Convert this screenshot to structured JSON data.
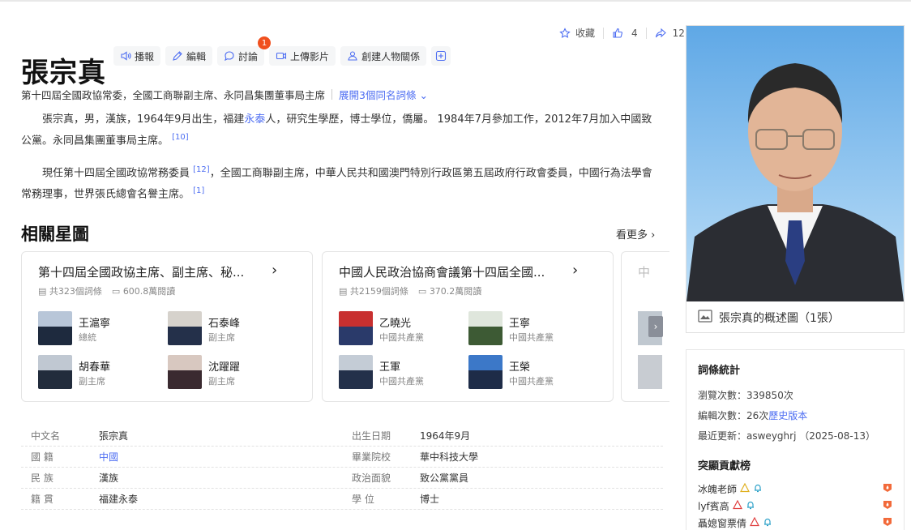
{
  "header": {
    "favorite": "收藏",
    "likes": "4",
    "shares": "12"
  },
  "title": "張宗真",
  "toolbar": {
    "broadcast": "播報",
    "edit": "編輯",
    "discuss": "討論",
    "discuss_badge": "1",
    "upload": "上傳影片",
    "relation": "創建人物關係"
  },
  "subtitle": {
    "text": "第十四屆全國政協常委，全國工商聯副主席、永同昌集團董事局主席",
    "expand": "展開3個同名詞條"
  },
  "para1": {
    "a": "張宗真，男，漢族，1964年9月出生，福建",
    "link": "永泰",
    "b": "人，研究生學歷，博士學位，僑屬。 1984年7月參加工作，2012年7月加入中國致公黨。永同昌集團董事局主席。",
    "ref": "[10]"
  },
  "para2": {
    "a": "現任第十四屆全國政協常務委員",
    "ref1": "[12]",
    "b": "，全國工商聯副主席，中華人民共和國澳門特別行政區第五屆政府行政會委員，中國行為法學會常務理事，世界張氏總會名譽主席。",
    "ref2": "[1]"
  },
  "related": {
    "title": "相關星圖",
    "more": "看更多",
    "cards": [
      {
        "title": "第十四屆全國政協主席、副主席、秘...",
        "entries": "共323個詞條",
        "views": "600.8萬閱讀",
        "people": [
          {
            "name": "王滬寧",
            "role": "總統"
          },
          {
            "name": "石泰峰",
            "role": "副主席"
          },
          {
            "name": "胡春華",
            "role": "副主席"
          },
          {
            "name": "沈躍躍",
            "role": "副主席"
          }
        ]
      },
      {
        "title": "中國人民政治協商會議第十四屆全國...",
        "entries": "共2159個詞條",
        "views": "370.2萬閱讀",
        "people": [
          {
            "name": "乙曉光",
            "role": "中國共產黨"
          },
          {
            "name": "王寧",
            "role": "中國共產黨"
          },
          {
            "name": "王軍",
            "role": "中國共產黨"
          },
          {
            "name": "王榮",
            "role": "中國共產黨"
          }
        ]
      }
    ],
    "card3_title": "中"
  },
  "info": [
    {
      "l1": "中文名",
      "v1": "張宗真",
      "l2": "出生日期",
      "v2": "1964年9月"
    },
    {
      "l1": "國 籍",
      "v1": "中國",
      "l2": "畢業院校",
      "v2": "華中科技大學"
    },
    {
      "l1": "民 族",
      "v1": "漢族",
      "l2": "政治面貌",
      "v2": "致公黨黨員"
    },
    {
      "l1": "籍 貫",
      "v1": "福建永泰",
      "l2": "學 位",
      "v2": "博士"
    }
  ],
  "photo": {
    "caption": "張宗真的概述圖（1張）"
  },
  "stats": {
    "title": "詞條統計",
    "views_label": "瀏覽次數：",
    "views": "339850次",
    "edits_label": "編輯次數：",
    "edits": "26次",
    "history": "歷史版本",
    "updated_label": "最近更新：",
    "updated": "asweyghrj （2025-08-13）",
    "contrib_title": "突顯貢獻榜",
    "contributors": [
      "冰魄老師",
      "lyf賓高",
      "聶媳窗票倩"
    ]
  },
  "colors": {
    "link": "#4e6ef2",
    "badge": "#f0501e"
  }
}
